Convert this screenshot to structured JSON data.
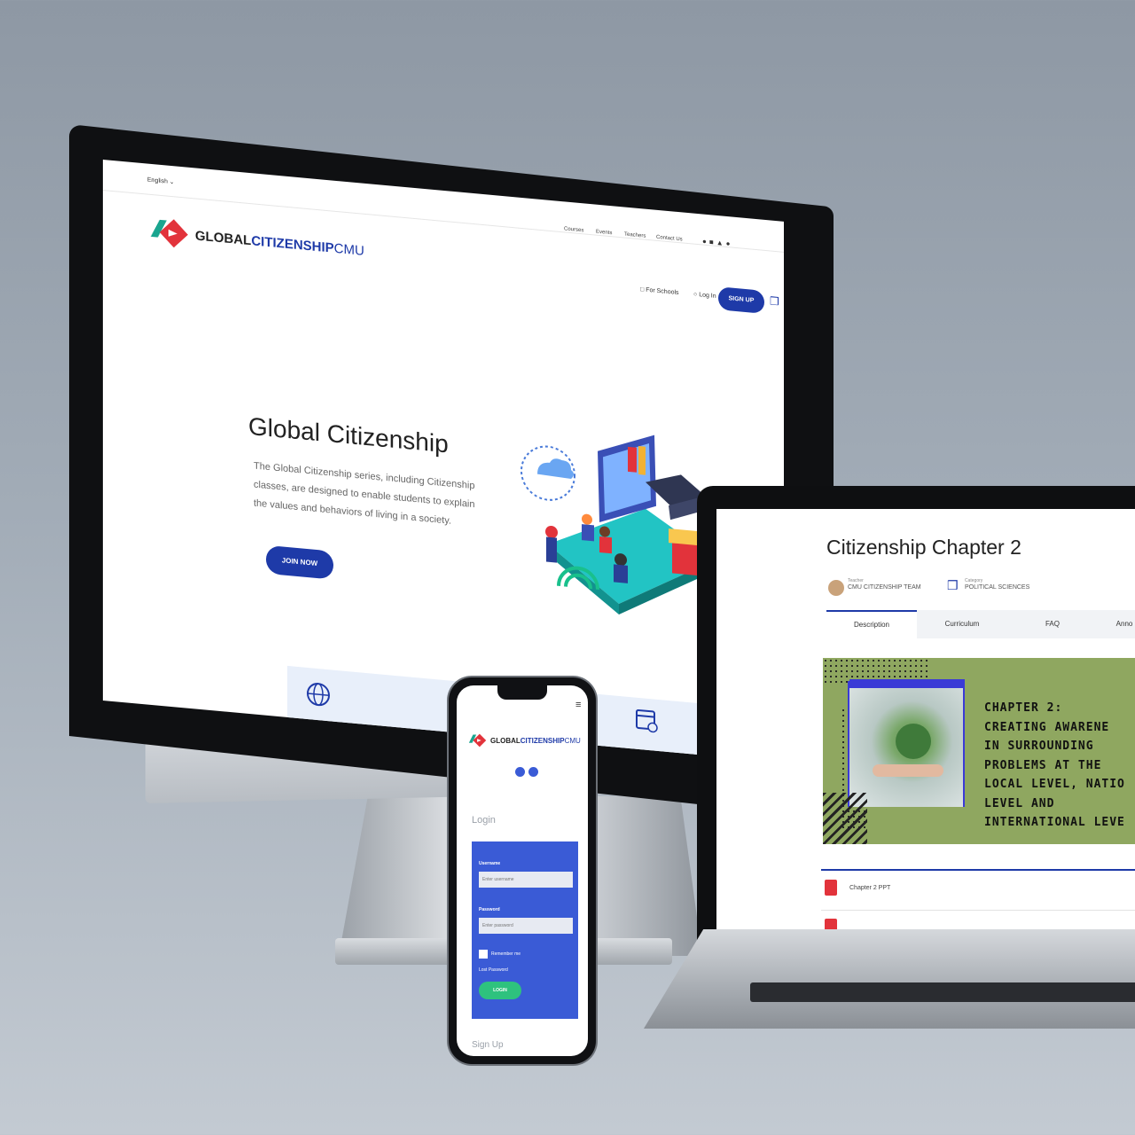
{
  "desktop": {
    "language": "English",
    "logo": {
      "part1": "GLOBAL",
      "part2": "CITIZENSHIP",
      "part3": "CMU"
    },
    "nav": [
      "Courses",
      "Events",
      "Teachers",
      "Contact Us"
    ],
    "for_schools": "For Schools",
    "login": "Log In",
    "signup": "SIGN UP",
    "hero_title": "Global Citizenship",
    "hero_text": [
      "The Global Citizenship series, including Citizenship",
      "classes, are designed to enable students to explain",
      "the values and behaviors of living in a society."
    ],
    "join_now": "JOIN NOW",
    "colors": {
      "brand_blue": "#1e3aa8",
      "logo_red": "#e2333b",
      "logo_teal": "#19a58f"
    }
  },
  "laptop": {
    "title": "Citizenship Chapter 2",
    "teacher_label": "Teacher",
    "teacher_name": "CMU CITIZENSHIP TEAM",
    "category_label": "Category",
    "category_name": "POLITICAL SCIENCES",
    "tabs": [
      "Description",
      "Curriculum",
      "FAQ",
      "Anno"
    ],
    "banner_lines": [
      "CHAPTER 2:",
      "CREATING AWARENE",
      "IN SURROUNDING",
      "PROBLEMS AT THE",
      "LOCAL LEVEL, NATIO",
      "LEVEL AND",
      "INTERNATIONAL LEVE"
    ],
    "file_item": "Chapter 2 PPT",
    "colors": {
      "banner_green": "#8fa760"
    }
  },
  "phone": {
    "logo": {
      "part1": "GLOBAL",
      "part2": "CITIZENSHIP",
      "part3": "CMU"
    },
    "login_heading": "Login",
    "username_label": "Username",
    "username_placeholder": "Enter username",
    "password_label": "Password",
    "password_placeholder": "Enter password",
    "remember": "Remember me",
    "lost_password": "Lost Password",
    "login_button": "LOGIN",
    "signup_link": "Sign Up",
    "colors": {
      "panel_blue": "#3a5bd6",
      "button_green": "#2ec27e"
    }
  }
}
